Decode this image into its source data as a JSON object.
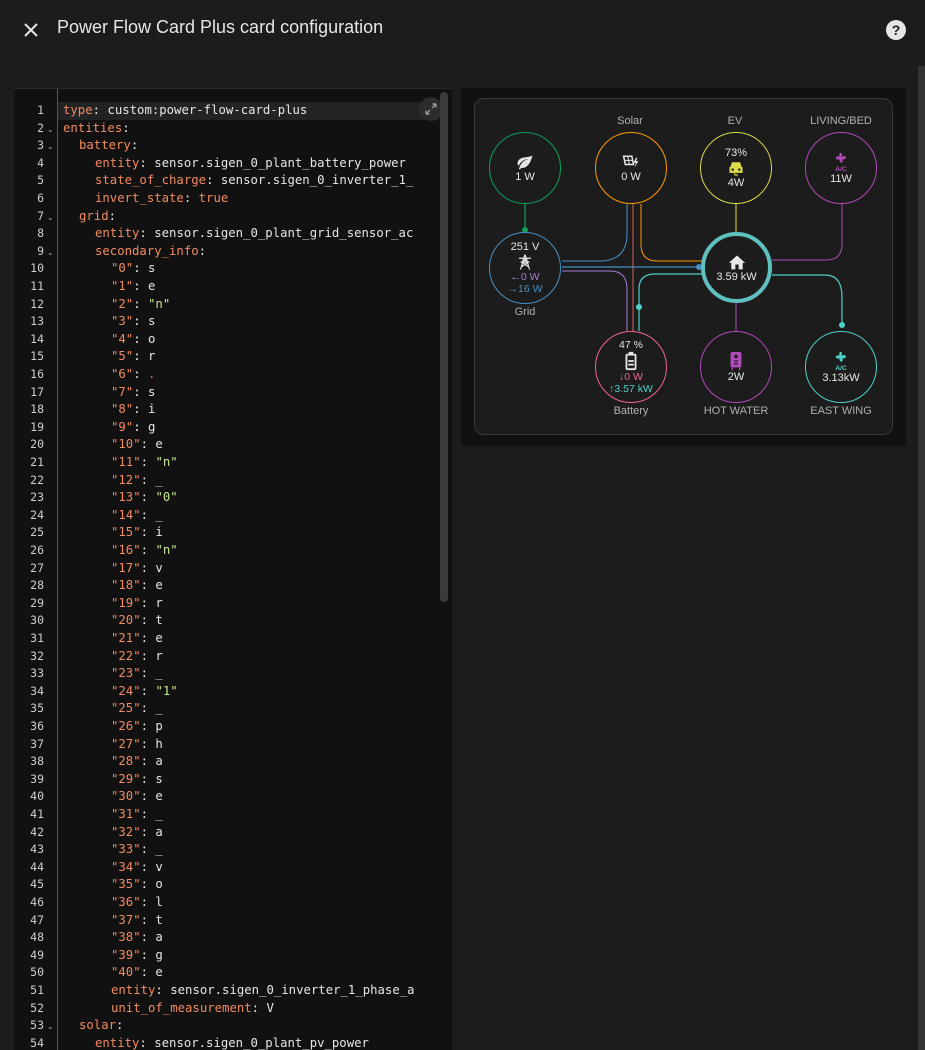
{
  "dialog": {
    "title": "Power Flow Card Plus card configuration",
    "close_icon": "close-icon",
    "help_icon": "help-circle-icon"
  },
  "editor": {
    "active_line": 1,
    "lines": [
      {
        "n": 1,
        "fold": false,
        "indent": 0,
        "parts": [
          [
            "k",
            "type"
          ],
          [
            "v",
            ": custom:power-flow-card-plus"
          ]
        ]
      },
      {
        "n": 2,
        "fold": true,
        "indent": 0,
        "parts": [
          [
            "k",
            "entities"
          ],
          [
            "v",
            ":"
          ]
        ]
      },
      {
        "n": 3,
        "fold": true,
        "indent": 1,
        "parts": [
          [
            "k",
            "battery"
          ],
          [
            "v",
            ":"
          ]
        ]
      },
      {
        "n": 4,
        "fold": false,
        "indent": 2,
        "parts": [
          [
            "k",
            "entity"
          ],
          [
            "v",
            ": sensor.sigen_0_plant_battery_power"
          ]
        ]
      },
      {
        "n": 5,
        "fold": false,
        "indent": 2,
        "parts": [
          [
            "k",
            "state_of_charge"
          ],
          [
            "v",
            ": sensor.sigen_0_inverter_1_"
          ]
        ]
      },
      {
        "n": 6,
        "fold": false,
        "indent": 2,
        "parts": [
          [
            "k",
            "invert_state"
          ],
          [
            "v",
            ": "
          ],
          [
            "k",
            "true"
          ]
        ]
      },
      {
        "n": 7,
        "fold": true,
        "indent": 1,
        "parts": [
          [
            "k",
            "grid"
          ],
          [
            "v",
            ":"
          ]
        ]
      },
      {
        "n": 8,
        "fold": false,
        "indent": 2,
        "parts": [
          [
            "k",
            "entity"
          ],
          [
            "v",
            ": sensor.sigen_0_plant_grid_sensor_ac"
          ]
        ]
      },
      {
        "n": 9,
        "fold": true,
        "indent": 2,
        "parts": [
          [
            "k",
            "secondary_info"
          ],
          [
            "v",
            ":"
          ]
        ]
      },
      {
        "n": 10,
        "fold": false,
        "indent": 3,
        "parts": [
          [
            "k",
            "\"0\""
          ],
          [
            "v",
            ": s"
          ]
        ]
      },
      {
        "n": 11,
        "fold": false,
        "indent": 3,
        "parts": [
          [
            "k",
            "\"1\""
          ],
          [
            "v",
            ": e"
          ]
        ]
      },
      {
        "n": 12,
        "fold": false,
        "indent": 3,
        "parts": [
          [
            "k",
            "\"2\""
          ],
          [
            "v",
            ": "
          ],
          [
            "s",
            "\"n\""
          ]
        ]
      },
      {
        "n": 13,
        "fold": false,
        "indent": 3,
        "parts": [
          [
            "k",
            "\"3\""
          ],
          [
            "v",
            ": s"
          ]
        ]
      },
      {
        "n": 14,
        "fold": false,
        "indent": 3,
        "parts": [
          [
            "k",
            "\"4\""
          ],
          [
            "v",
            ": o"
          ]
        ]
      },
      {
        "n": 15,
        "fold": false,
        "indent": 3,
        "parts": [
          [
            "k",
            "\"5\""
          ],
          [
            "v",
            ": r"
          ]
        ]
      },
      {
        "n": 16,
        "fold": false,
        "indent": 3,
        "parts": [
          [
            "k",
            "\"6\""
          ],
          [
            "v",
            ": "
          ],
          [
            "r",
            "."
          ]
        ]
      },
      {
        "n": 17,
        "fold": false,
        "indent": 3,
        "parts": [
          [
            "k",
            "\"7\""
          ],
          [
            "v",
            ": s"
          ]
        ]
      },
      {
        "n": 18,
        "fold": false,
        "indent": 3,
        "parts": [
          [
            "k",
            "\"8\""
          ],
          [
            "v",
            ": i"
          ]
        ]
      },
      {
        "n": 19,
        "fold": false,
        "indent": 3,
        "parts": [
          [
            "k",
            "\"9\""
          ],
          [
            "v",
            ": g"
          ]
        ]
      },
      {
        "n": 20,
        "fold": false,
        "indent": 3,
        "parts": [
          [
            "k",
            "\"10\""
          ],
          [
            "v",
            ": e"
          ]
        ]
      },
      {
        "n": 21,
        "fold": false,
        "indent": 3,
        "parts": [
          [
            "k",
            "\"11\""
          ],
          [
            "v",
            ": "
          ],
          [
            "s",
            "\"n\""
          ]
        ]
      },
      {
        "n": 22,
        "fold": false,
        "indent": 3,
        "parts": [
          [
            "k",
            "\"12\""
          ],
          [
            "v",
            ": _"
          ]
        ]
      },
      {
        "n": 23,
        "fold": false,
        "indent": 3,
        "parts": [
          [
            "k",
            "\"13\""
          ],
          [
            "v",
            ": "
          ],
          [
            "s",
            "\"0\""
          ]
        ]
      },
      {
        "n": 24,
        "fold": false,
        "indent": 3,
        "parts": [
          [
            "k",
            "\"14\""
          ],
          [
            "v",
            ": _"
          ]
        ]
      },
      {
        "n": 25,
        "fold": false,
        "indent": 3,
        "parts": [
          [
            "k",
            "\"15\""
          ],
          [
            "v",
            ": i"
          ]
        ]
      },
      {
        "n": 26,
        "fold": false,
        "indent": 3,
        "parts": [
          [
            "k",
            "\"16\""
          ],
          [
            "v",
            ": "
          ],
          [
            "s",
            "\"n\""
          ]
        ]
      },
      {
        "n": 27,
        "fold": false,
        "indent": 3,
        "parts": [
          [
            "k",
            "\"17\""
          ],
          [
            "v",
            ": v"
          ]
        ]
      },
      {
        "n": 28,
        "fold": false,
        "indent": 3,
        "parts": [
          [
            "k",
            "\"18\""
          ],
          [
            "v",
            ": e"
          ]
        ]
      },
      {
        "n": 29,
        "fold": false,
        "indent": 3,
        "parts": [
          [
            "k",
            "\"19\""
          ],
          [
            "v",
            ": r"
          ]
        ]
      },
      {
        "n": 30,
        "fold": false,
        "indent": 3,
        "parts": [
          [
            "k",
            "\"20\""
          ],
          [
            "v",
            ": t"
          ]
        ]
      },
      {
        "n": 31,
        "fold": false,
        "indent": 3,
        "parts": [
          [
            "k",
            "\"21\""
          ],
          [
            "v",
            ": e"
          ]
        ]
      },
      {
        "n": 32,
        "fold": false,
        "indent": 3,
        "parts": [
          [
            "k",
            "\"22\""
          ],
          [
            "v",
            ": r"
          ]
        ]
      },
      {
        "n": 33,
        "fold": false,
        "indent": 3,
        "parts": [
          [
            "k",
            "\"23\""
          ],
          [
            "v",
            ": _"
          ]
        ]
      },
      {
        "n": 34,
        "fold": false,
        "indent": 3,
        "parts": [
          [
            "k",
            "\"24\""
          ],
          [
            "v",
            ": "
          ],
          [
            "s",
            "\"1\""
          ]
        ]
      },
      {
        "n": 35,
        "fold": false,
        "indent": 3,
        "parts": [
          [
            "k",
            "\"25\""
          ],
          [
            "v",
            ": _"
          ]
        ]
      },
      {
        "n": 36,
        "fold": false,
        "indent": 3,
        "parts": [
          [
            "k",
            "\"26\""
          ],
          [
            "v",
            ": p"
          ]
        ]
      },
      {
        "n": 37,
        "fold": false,
        "indent": 3,
        "parts": [
          [
            "k",
            "\"27\""
          ],
          [
            "v",
            ": h"
          ]
        ]
      },
      {
        "n": 38,
        "fold": false,
        "indent": 3,
        "parts": [
          [
            "k",
            "\"28\""
          ],
          [
            "v",
            ": a"
          ]
        ]
      },
      {
        "n": 39,
        "fold": false,
        "indent": 3,
        "parts": [
          [
            "k",
            "\"29\""
          ],
          [
            "v",
            ": s"
          ]
        ]
      },
      {
        "n": 40,
        "fold": false,
        "indent": 3,
        "parts": [
          [
            "k",
            "\"30\""
          ],
          [
            "v",
            ": e"
          ]
        ]
      },
      {
        "n": 41,
        "fold": false,
        "indent": 3,
        "parts": [
          [
            "k",
            "\"31\""
          ],
          [
            "v",
            ": _"
          ]
        ]
      },
      {
        "n": 42,
        "fold": false,
        "indent": 3,
        "parts": [
          [
            "k",
            "\"32\""
          ],
          [
            "v",
            ": a"
          ]
        ]
      },
      {
        "n": 43,
        "fold": false,
        "indent": 3,
        "parts": [
          [
            "k",
            "\"33\""
          ],
          [
            "v",
            ": _"
          ]
        ]
      },
      {
        "n": 44,
        "fold": false,
        "indent": 3,
        "parts": [
          [
            "k",
            "\"34\""
          ],
          [
            "v",
            ": v"
          ]
        ]
      },
      {
        "n": 45,
        "fold": false,
        "indent": 3,
        "parts": [
          [
            "k",
            "\"35\""
          ],
          [
            "v",
            ": o"
          ]
        ]
      },
      {
        "n": 46,
        "fold": false,
        "indent": 3,
        "parts": [
          [
            "k",
            "\"36\""
          ],
          [
            "v",
            ": l"
          ]
        ]
      },
      {
        "n": 47,
        "fold": false,
        "indent": 3,
        "parts": [
          [
            "k",
            "\"37\""
          ],
          [
            "v",
            ": t"
          ]
        ]
      },
      {
        "n": 48,
        "fold": false,
        "indent": 3,
        "parts": [
          [
            "k",
            "\"38\""
          ],
          [
            "v",
            ": a"
          ]
        ]
      },
      {
        "n": 49,
        "fold": false,
        "indent": 3,
        "parts": [
          [
            "k",
            "\"39\""
          ],
          [
            "v",
            ": g"
          ]
        ]
      },
      {
        "n": 50,
        "fold": false,
        "indent": 3,
        "parts": [
          [
            "k",
            "\"40\""
          ],
          [
            "v",
            ": e"
          ]
        ]
      },
      {
        "n": 51,
        "fold": false,
        "indent": 3,
        "parts": [
          [
            "k",
            "entity"
          ],
          [
            "v",
            ": sensor.sigen_0_inverter_1_phase_a"
          ]
        ]
      },
      {
        "n": 52,
        "fold": false,
        "indent": 3,
        "parts": [
          [
            "k",
            "unit_of_measurement"
          ],
          [
            "v",
            ": V"
          ]
        ]
      },
      {
        "n": 53,
        "fold": true,
        "indent": 1,
        "parts": [
          [
            "k",
            "solar"
          ],
          [
            "v",
            ":"
          ]
        ]
      },
      {
        "n": 54,
        "fold": false,
        "indent": 2,
        "parts": [
          [
            "k",
            "entity"
          ],
          [
            "v",
            ": sensor.sigen_0_plant_pv_power"
          ]
        ]
      }
    ]
  },
  "preview": {
    "nodes": {
      "low_carbon": {
        "icon": "leaf-icon",
        "value": "1 W",
        "color": "#0f9d58"
      },
      "solar": {
        "label": "Solar",
        "icon": "solar-power-icon",
        "value": "0 W",
        "color": "#ff9800"
      },
      "ev": {
        "label": "EV",
        "icon": "car-icon",
        "top": "73%",
        "value": "4W",
        "color": "#dcdc4a"
      },
      "living": {
        "label": "LIVING/BED",
        "icon": "air-conditioner-icon",
        "value": "11W",
        "color": "#b04ab9"
      },
      "grid": {
        "label": "Grid",
        "icon": "transmission-tower-icon",
        "top": "251 V",
        "import": "←0 W",
        "export": "→16 W",
        "color": "#488fc2"
      },
      "home": {
        "icon": "home-icon",
        "value": "3.59 kW",
        "color": "#5fc0c0"
      },
      "battery": {
        "label": "Battery",
        "icon": "battery-icon",
        "top": "47 %",
        "in": "↓0 W",
        "out": "↑3.57 kW",
        "color": "#f06292"
      },
      "hot_water": {
        "label": "HOT WATER",
        "icon": "water-heater-icon",
        "value": "2W",
        "color": "#b04ab9"
      },
      "east_wing": {
        "label": "EAST WING",
        "icon": "air-conditioner-icon",
        "value": "3.13kW",
        "color": "#4dd0c8"
      }
    },
    "colors": {
      "grid_in": "#a87ddc",
      "grid_out": "#488fc2",
      "battery_in": "#f06292",
      "battery_out": "#4dd0c8"
    }
  }
}
